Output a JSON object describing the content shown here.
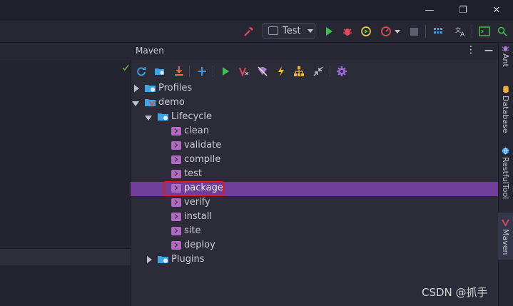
{
  "window": {
    "minimize_label": "—",
    "restore_label": "❐",
    "close_label": "✕"
  },
  "toolbar": {
    "run_config": "Test",
    "icons": [
      "hammer-icon",
      "run-icon",
      "debug-icon",
      "coverage-icon",
      "profiler-icon",
      "stop-icon",
      "structure-icon",
      "translate-icon",
      "terminal-icon",
      "search-icon"
    ]
  },
  "maven": {
    "title": "Maven",
    "menu_label": "⋮",
    "hide_label": "—",
    "toolbar_icons": [
      "reload-icon",
      "generate-sources-icon",
      "download-icon",
      "add-icon",
      "run-icon",
      "maven-goal-icon",
      "skip-tests-icon",
      "lightning-icon",
      "dependencies-icon",
      "collapse-icon",
      "settings-icon"
    ],
    "tree": [
      {
        "label": "Profiles",
        "type": "folder",
        "level": 0,
        "expanded": false
      },
      {
        "label": "demo",
        "type": "project",
        "level": 0,
        "expanded": true
      },
      {
        "label": "Lifecycle",
        "type": "folder",
        "level": 1,
        "expanded": true
      },
      {
        "label": "clean",
        "type": "goal",
        "level": 2
      },
      {
        "label": "validate",
        "type": "goal",
        "level": 2
      },
      {
        "label": "compile",
        "type": "goal",
        "level": 2
      },
      {
        "label": "test",
        "type": "goal",
        "level": 2
      },
      {
        "label": "package",
        "type": "goal",
        "level": 2,
        "selected": true
      },
      {
        "label": "verify",
        "type": "goal",
        "level": 2
      },
      {
        "label": "install",
        "type": "goal",
        "level": 2
      },
      {
        "label": "site",
        "type": "goal",
        "level": 2
      },
      {
        "label": "deploy",
        "type": "goal",
        "level": 2
      },
      {
        "label": "Plugins",
        "type": "folder",
        "level": 1,
        "expanded": false
      }
    ]
  },
  "right_sidebar": {
    "tabs": [
      {
        "label": "Ant",
        "icon": "ant-icon"
      },
      {
        "label": "Database",
        "icon": "database-icon"
      },
      {
        "label": "RestfulTool",
        "icon": "globe-icon"
      },
      {
        "label": "Maven",
        "icon": "maven-icon",
        "active": true
      }
    ]
  },
  "watermark": "CSDN @抓手",
  "colors": {
    "selection": "#6e3e9a",
    "highlight_border": "#e01a1a",
    "run_green": "#3fbf4a",
    "debug_red": "#e0475b",
    "accent_blue": "#3ea4e8"
  }
}
